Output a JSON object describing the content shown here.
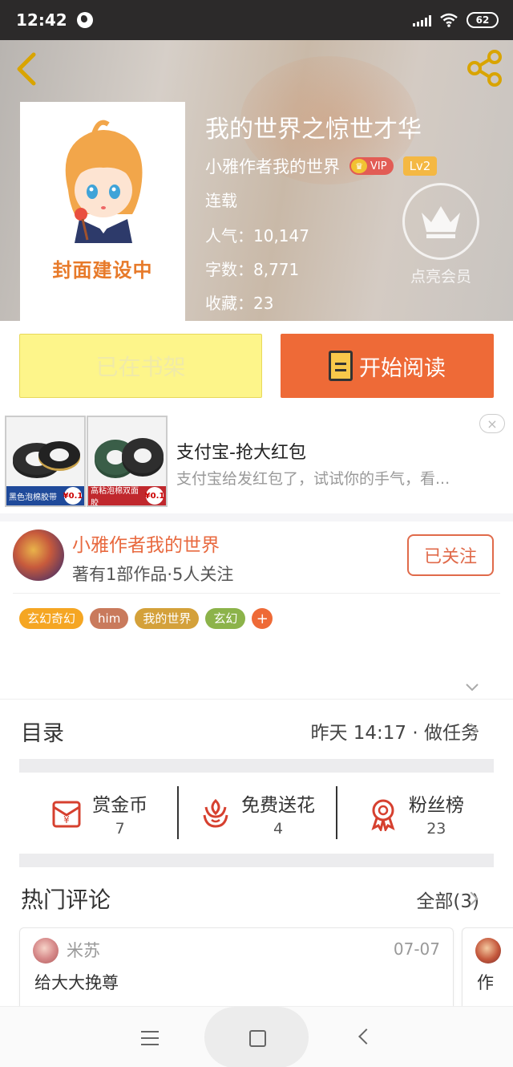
{
  "status_bar": {
    "time": "12:42",
    "battery": "62"
  },
  "book": {
    "title": "我的世界之惊世才华",
    "author": "小雅作者我的世界",
    "vip": "VIP",
    "level": "Lv2",
    "status": "连载",
    "popularity": "人气：10,147",
    "word_count": "字数：8,771",
    "favorites": "收藏：23",
    "cover_text": "封面建设中",
    "member_label": "点亮会员"
  },
  "actions": {
    "shelf_label": "已在书架",
    "read_label": "开始阅读"
  },
  "ad": {
    "title": "支付宝-抢大红包",
    "desc": "支付宝给发红包了，试试你的手气，看...",
    "close": "×",
    "img1_caption": "黑色泡棉胶带",
    "img2_caption": "高粘泡棉双面胶",
    "price": "¥0.1"
  },
  "author_section": {
    "name": "小雅作者我的世界",
    "stats": "著有1部作品·5人关注",
    "follow_label": "已关注",
    "tags": [
      "玄幻奇幻",
      "him",
      "我的世界",
      "玄幻"
    ],
    "tag_colors": [
      "#f5a623",
      "#c97a5c",
      "#d4a13a",
      "#8cb34a"
    ],
    "add_tag": "+"
  },
  "catalog": {
    "label": "目录",
    "info": "昨天 14:17 · 做任务"
  },
  "rewards": [
    {
      "label": "赏金币",
      "value": "7",
      "icon": "coin-envelope-icon"
    },
    {
      "label": "免费送花",
      "value": "4",
      "icon": "flower-icon"
    },
    {
      "label": "粉丝榜",
      "value": "23",
      "icon": "medal-icon"
    }
  ],
  "comments": {
    "label": "热门评论",
    "all_label": "全部(3)",
    "items": [
      {
        "user": "米苏",
        "date": "07-07",
        "text": "给大大挽尊"
      },
      {
        "user": "",
        "date": "",
        "text": "作"
      }
    ]
  },
  "colors": {
    "accent": "#ee6a37",
    "author": "#e8693f",
    "shelf": "#fdf58a"
  }
}
